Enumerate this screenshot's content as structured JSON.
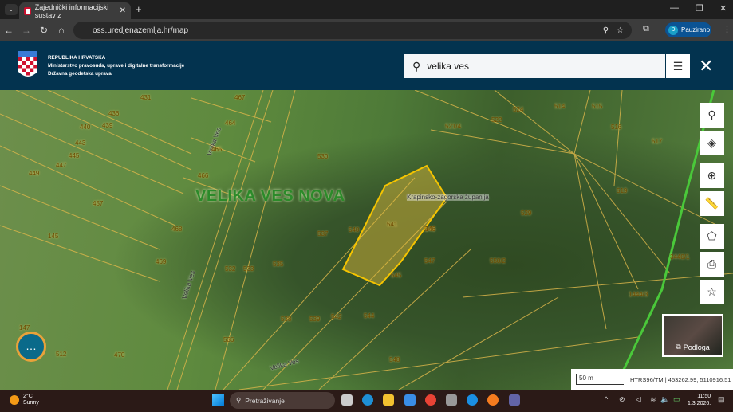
{
  "browser": {
    "tab_title": "Zajednički informacijski sustav z",
    "url": "oss.uredjenazemlja.hr/map",
    "profile_initial": "D",
    "profile_label": "Pauzirano"
  },
  "header": {
    "org_line1": "REPUBLIKA HRVATSKA",
    "org_line2": "Ministarstvo pravosuđa, uprave i digitalne transformacije",
    "org_line3": "Državna geodetska uprava",
    "search_value": "velika ves"
  },
  "map": {
    "village_label": "VELIKA VES NOVA",
    "county_label": "Krapinsko-zagorska županija",
    "road_labels": [
      "Velika Ves",
      "Velika Ves",
      "Velika Ves"
    ],
    "parcels": [
      "431",
      "467",
      "436",
      "440",
      "439",
      "443",
      "445",
      "447",
      "449",
      "464",
      "465",
      "466",
      "457",
      "145",
      "468",
      "469",
      "530",
      "537",
      "540",
      "541",
      "546",
      "547",
      "545",
      "529",
      "524",
      "522",
      "521/4",
      "514",
      "515",
      "516",
      "517",
      "519",
      "146",
      "470",
      "536",
      "538",
      "539",
      "542",
      "544",
      "548",
      "550/2",
      "535",
      "532",
      "533",
      "147",
      "512",
      "1444/3",
      "3440/1"
    ],
    "highlight_color": "#f5c400",
    "podloga_label": "Podloga",
    "scale_label": "50 m",
    "coords_label": "HTRS96/TM | 453262.99, 5110916.51"
  },
  "taskbar": {
    "temperature": "2°C",
    "weather": "Sunny",
    "search_placeholder": "Pretraživanje",
    "time": "11:50",
    "date": "1.3.2026."
  }
}
